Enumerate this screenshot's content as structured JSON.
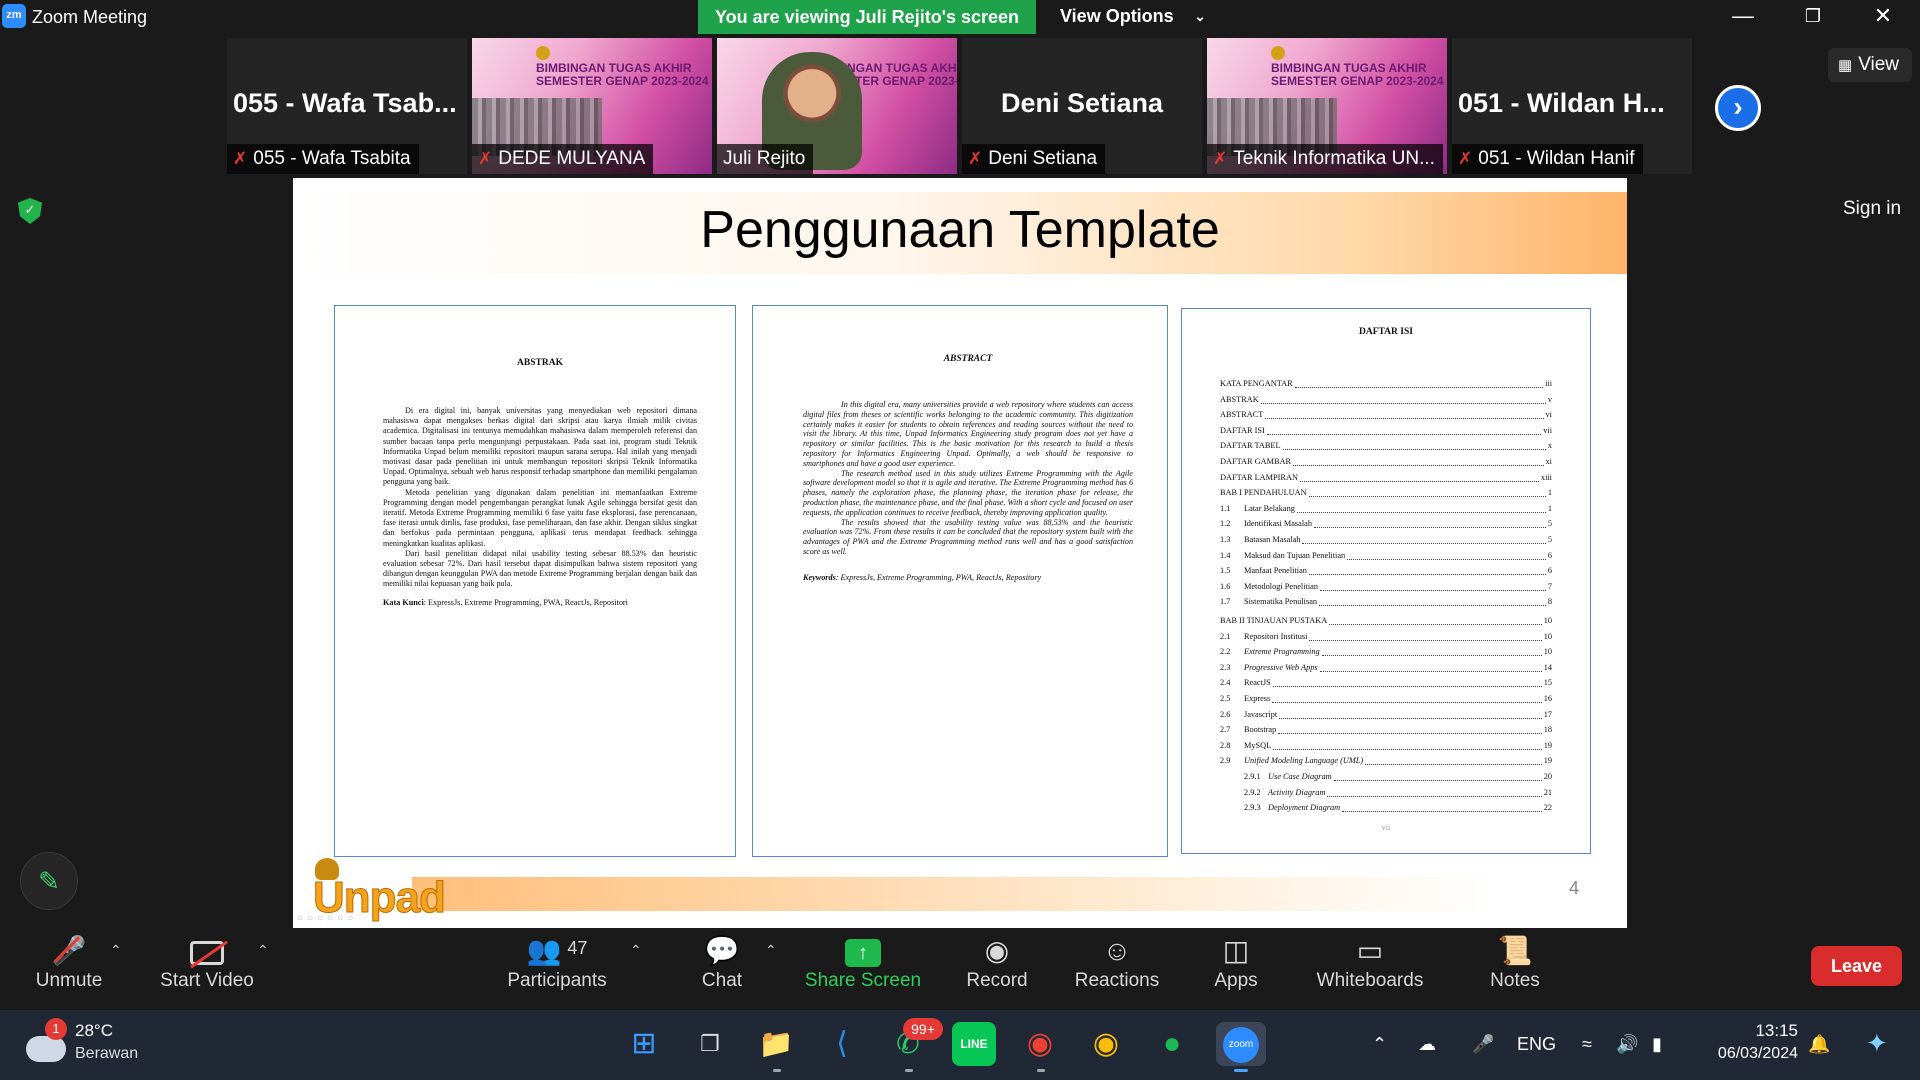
{
  "window": {
    "app_title": "Zoom Meeting",
    "logo": "zm"
  },
  "banner": {
    "viewing": "You are viewing Juli Rejito's screen",
    "view_options": "View Options"
  },
  "participants_strip": [
    {
      "big_name": "055 - Wafa Tsab...",
      "label": "055 - Wafa Tsabita",
      "muted": true,
      "type": "name"
    },
    {
      "big_name": "",
      "label": "DEDE MULYANA",
      "muted": true,
      "type": "poster"
    },
    {
      "big_name": "",
      "label": "Juli Rejito",
      "muted": false,
      "type": "video"
    },
    {
      "big_name": "Deni Setiana",
      "label": "Deni Setiana",
      "muted": true,
      "type": "name"
    },
    {
      "big_name": "",
      "label": "Teknik Informatika UN...",
      "muted": true,
      "type": "poster"
    },
    {
      "big_name": "051 - Wildan H...",
      "label": "051 - Wildan Hanif",
      "muted": true,
      "type": "name"
    }
  ],
  "poster": {
    "line1": "BIMBINGAN TUGAS AKHIR",
    "line2": "SEMESTER GENAP 2023-2024"
  },
  "side": {
    "view_label": "View",
    "sign_in": "Sign in"
  },
  "slide": {
    "title": "Penggunaan Template",
    "number": "4",
    "logo_text": "Unpad",
    "abstrak": {
      "heading": "ABSTRAK",
      "para1": "Di era digital ini, banyak universitas yang menyediakan web repositori dimana mahasiswa dapat mengakses berkas digital dari skripsi atau karya ilmiah milik civitas academica. Digitalisasi ini tentunya memudahkan mahasiswa dalam memperoleh referensi dan sumber bacaan tanpa perlu mengunjungi perpustakaan. Pada saat ini, program studi Teknik Informatika Unpad belum memiliki repositori maupun sarana serupa. Hal inilah yang menjadi motivasi dasar pada penelitian ini untuk membangun repositori skripsi Teknik Informatika Unpad. Optimalnya, sebuah web harus responsif terhadap smartphone dan memiliki pengalaman pengguna yang baik.",
      "para2": "Metoda penelitian yang digunakan dalam penelitian ini memanfaatkan Extreme Programming dengan model pengembangan perangkat lunak Agile sehingga bersifat gesit dan iteratif. Metoda Extreme Programming memiliki 6 fase yaitu fase eksplorasi, fase perencanaan, fase iterasi untuk dirilis, fase produksi, fase pemeliharaan, dan fase akhir. Dengan siklus singkat dan berfokus pada permintaan pengguna, aplikasi terus mendapat feedback sehingga meningkatkan kualitas aplikasi.",
      "para3": "Dari hasil penelitian didapat nilai usability testing sebesar 88.53% dan heuristic evaluation sebesar 72%. Dari hasil tersebut dapat disimpulkan bahwa sistem repositori yang dibangun dengan keunggulan PWA dan metode Extreme Programming berjalan dengan baik dan memiliki nilai kepuasan yang baik pula.",
      "keywords_label": "Kata Kunci",
      "keywords": ": ExpressJs, Extreme Programming, PWA, ReactJs, Repositori"
    },
    "abstract": {
      "heading": "ABSTRACT",
      "para1": "In this digital era, many universities provide a web repository where students can access digital files from theses or scientific works belonging to the academic community. This digitization certainly makes it easier for students to obtain references and reading sources without the need to visit the library. At this time, Unpad Informatics Engineering study program does not yet have a repository or similar facilities. This is the basic motivation for this research to build a thesis repository for Informatics Engineering Unpad. Optimally, a web should be responsive to smartphones and have a good user experience.",
      "para2": "The research method used in this study utilizes Extreme Programming with the Agile software development model so that it is agile and iterative. The Extreme Programming method has 6 phases, namely the exploration phase, the planning phase, the iteration phase for release, the production phase, the maintenance phase, and the final phase. With a short cycle and focused on user requests, the application continues to receive feedback, thereby improving application quality.",
      "para3": "The results showed that the usability testing value was 88.53% and the heuristic evaluation was 72%. From these results it can be concluded that the repository system built with the advantages of PWA and the Extreme Programming method runs well and has a good satisfaction score as well.",
      "keywords_label": "Keywords",
      "keywords": ": ExpressJs, Extreme Programming, PWA, ReactJs, Repository"
    },
    "toc": {
      "heading": "DAFTAR ISI",
      "footer": "vii",
      "rows": [
        {
          "num": "",
          "title": "KATA PENGANTAR",
          "page": "iii",
          "italic": false,
          "indent": 0
        },
        {
          "num": "",
          "title": "ABSTRAK",
          "page": "v",
          "italic": false,
          "indent": 0
        },
        {
          "num": "",
          "title": "ABSTRACT",
          "page": "vi",
          "italic": false,
          "indent": 0
        },
        {
          "num": "",
          "title": "DAFTAR ISI",
          "page": "vii",
          "italic": false,
          "indent": 0
        },
        {
          "num": "",
          "title": "DAFTAR TABEL",
          "page": "x",
          "italic": false,
          "indent": 0
        },
        {
          "num": "",
          "title": "DAFTAR GAMBAR",
          "page": "xi",
          "italic": false,
          "indent": 0
        },
        {
          "num": "",
          "title": "DAFTAR LAMPIRAN",
          "page": "xiii",
          "italic": false,
          "indent": 0
        },
        {
          "num": "",
          "title": "BAB I PENDAHULUAN",
          "page": "1",
          "italic": false,
          "indent": 0
        },
        {
          "num": "1.1",
          "title": "Latar Belakang",
          "page": "1",
          "italic": false,
          "indent": 0
        },
        {
          "num": "1.2",
          "title": "Identifikasi Masalah",
          "page": "5",
          "italic": false,
          "indent": 0
        },
        {
          "num": "1.3",
          "title": "Batasan Masalah",
          "page": "5",
          "italic": false,
          "indent": 0
        },
        {
          "num": "1.4",
          "title": "Maksud dan Tujuan Penelitian",
          "page": "6",
          "italic": false,
          "indent": 0
        },
        {
          "num": "1.5",
          "title": "Manfaat Penelitian",
          "page": "6",
          "italic": false,
          "indent": 0
        },
        {
          "num": "1.6",
          "title": "Metodologi Penelitian",
          "page": "7",
          "italic": false,
          "indent": 0
        },
        {
          "num": "1.7",
          "title": "Sistematika Penulisan",
          "page": "8",
          "italic": false,
          "indent": 0
        },
        {
          "num": "",
          "title": "BAB II TINJAUAN PUSTAKA",
          "page": "10",
          "italic": false,
          "indent": 0
        },
        {
          "num": "2.1",
          "title": "Repositori Institusi",
          "page": "10",
          "italic": false,
          "indent": 0
        },
        {
          "num": "2.2",
          "title": "Extreme Programming",
          "page": "10",
          "italic": true,
          "indent": 0
        },
        {
          "num": "2.3",
          "title": "Progressive Web Apps",
          "page": "14",
          "italic": true,
          "indent": 0
        },
        {
          "num": "2.4",
          "title": "ReactJS",
          "page": "15",
          "italic": false,
          "indent": 0
        },
        {
          "num": "2.5",
          "title": "Express",
          "page": "16",
          "italic": false,
          "indent": 0
        },
        {
          "num": "2.6",
          "title": "Javascript",
          "page": "17",
          "italic": false,
          "indent": 0
        },
        {
          "num": "2.7",
          "title": "Bootstrap",
          "page": "18",
          "italic": false,
          "indent": 0
        },
        {
          "num": "2.8",
          "title": "MySQL",
          "page": "19",
          "italic": false,
          "indent": 0
        },
        {
          "num": "2.9",
          "title": "Unified Modeling Language (UML)",
          "page": "19",
          "italic": true,
          "indent": 0
        },
        {
          "num": "2.9.1",
          "title": "Use Case Diagram",
          "page": "20",
          "italic": true,
          "indent": 1
        },
        {
          "num": "2.9.2",
          "title": "Activity Diagram",
          "page": "21",
          "italic": true,
          "indent": 1
        },
        {
          "num": "2.9.3",
          "title": "Deployment Diagram",
          "page": "22",
          "italic": true,
          "indent": 1
        }
      ]
    }
  },
  "toolbar": {
    "unmute": "Unmute",
    "start_video": "Start Video",
    "participants": "Participants",
    "participants_count": "47",
    "chat": "Chat",
    "share_screen": "Share Screen",
    "record": "Record",
    "reactions": "Reactions",
    "apps": "Apps",
    "whiteboards": "Whiteboards",
    "notes": "Notes",
    "leave": "Leave"
  },
  "taskbar": {
    "weather_badge": "1",
    "temperature": "28°C",
    "weather_desc": "Berawan",
    "whatsapp_badge": "99+",
    "zoom_icon_label": "zoom",
    "language": "ENG",
    "time": "13:15",
    "date": "06/03/2024"
  },
  "colors": {
    "accent_green": "#1fa34a",
    "leave_red": "#d92c2c",
    "zoom_blue": "#2d8cff",
    "slide_orange": "#ffb46a"
  }
}
